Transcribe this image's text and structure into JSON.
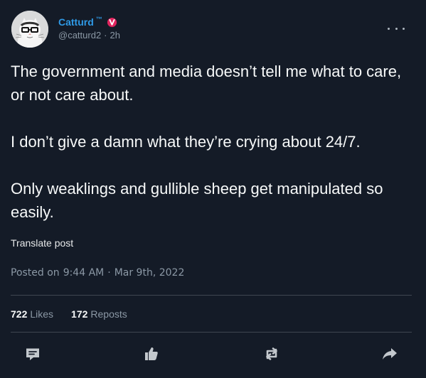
{
  "post": {
    "author": {
      "display_name": "Catturd",
      "trademark": "™",
      "handle": "@catturd2",
      "time": "2h",
      "separator": "·"
    },
    "body": {
      "paragraph_1": "The government and media doesn’t tell me what to care, or not care about.",
      "paragraph_2": "I don’t give a damn what they’re crying about 24/7.",
      "paragraph_3": "Only weaklings and gullible sheep get manipulated so easily."
    },
    "translate_label": "Translate post",
    "posted": {
      "prefix": "Posted on",
      "time": "9:44 AM",
      "separator": "·",
      "date": "Mar 9th, 2022"
    },
    "stats": {
      "likes_count": "722",
      "likes_label": "Likes",
      "reposts_count": "172",
      "reposts_label": "Reposts"
    }
  },
  "icons": {
    "more": "more-icon",
    "verified": "verified-badge-icon",
    "reply": "reply-icon",
    "like": "like-icon",
    "repost": "repost-icon",
    "share": "share-icon"
  },
  "colors": {
    "background": "#141b27",
    "accent": "#2f9ae6",
    "text": "#f7f9f9",
    "muted": "#8b98a5",
    "verified_badge": "#e0245e",
    "divider": "#3f4650"
  }
}
